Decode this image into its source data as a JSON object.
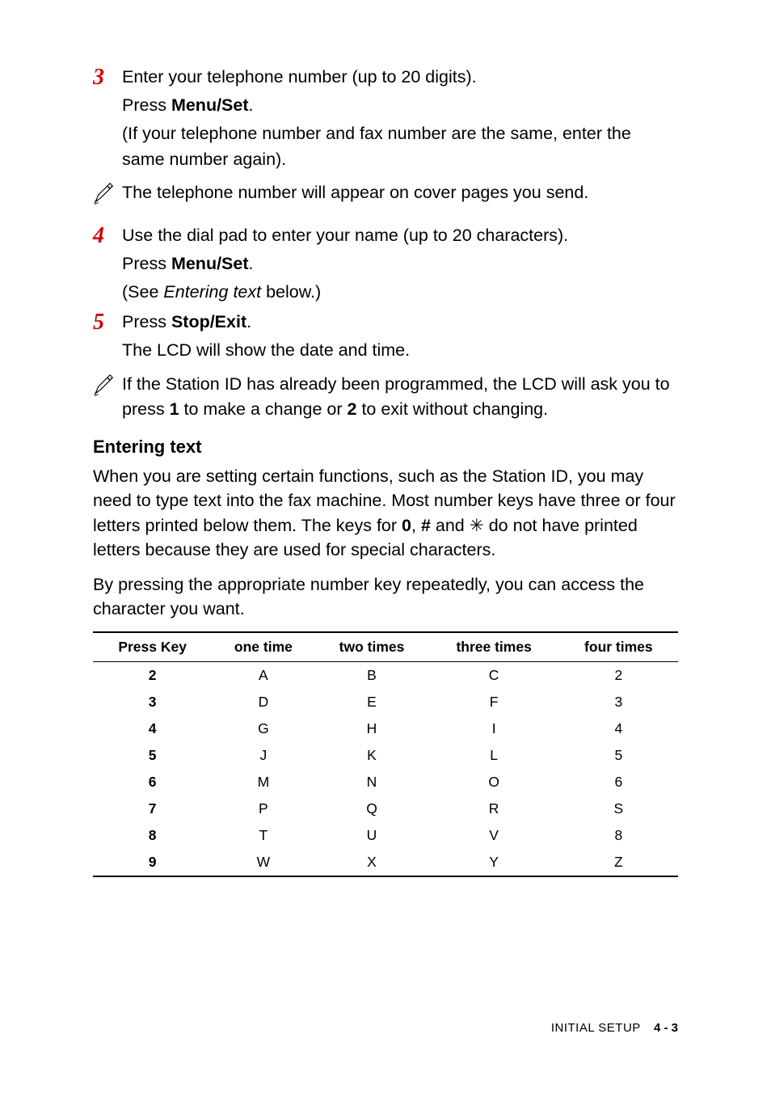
{
  "steps": {
    "s3": {
      "num": "3",
      "line1a": "Enter your telephone number (up to 20 digits).",
      "line2a": "Press ",
      "line2b": "Menu/Set",
      "line2c": ".",
      "line3": "(If your telephone number and fax number are the same, enter the same number again)."
    },
    "s4": {
      "num": "4",
      "line1": "Use the dial pad to enter your name (up to 20 characters).",
      "line2a": "Press ",
      "line2b": "Menu/Set",
      "line2c": ".",
      "line3a": "(See ",
      "line3b": "Entering text",
      "line3c": " below.)"
    },
    "s5": {
      "num": "5",
      "line1a": "Press ",
      "line1b": "Stop/Exit",
      "line1c": ".",
      "line2": "The LCD will show the date and time."
    }
  },
  "notes": {
    "n1": "The telephone number will appear on cover pages you send.",
    "n2a": "If the Station ID has already been programmed, the LCD will ask you to press ",
    "n2b": "1",
    "n2c": " to make a change or ",
    "n2d": "2",
    "n2e": " to exit without changing."
  },
  "section_heading": "Entering text",
  "paras": {
    "p1a": "When you are setting certain functions, such as the Station ID, you may need to type text into the fax machine. Most number keys have three or four letters printed below them. The keys for ",
    "p1b": "0",
    "p1c": ", ",
    "p1d": "#",
    "p1e": " and ",
    "p1star": "✳",
    "p1f": " do not have printed letters because they are used for special characters.",
    "p2": "By pressing the appropriate number key repeatedly, you can access the character you want."
  },
  "table": {
    "headers": [
      "Press Key",
      "one time",
      "two times",
      "three times",
      "four times"
    ],
    "rows": [
      [
        "2",
        "A",
        "B",
        "C",
        "2"
      ],
      [
        "3",
        "D",
        "E",
        "F",
        "3"
      ],
      [
        "4",
        "G",
        "H",
        "I",
        "4"
      ],
      [
        "5",
        "J",
        "K",
        "L",
        "5"
      ],
      [
        "6",
        "M",
        "N",
        "O",
        "6"
      ],
      [
        "7",
        "P",
        "Q",
        "R",
        "S"
      ],
      [
        "8",
        "T",
        "U",
        "V",
        "8"
      ],
      [
        "9",
        "W",
        "X",
        "Y",
        "Z"
      ]
    ]
  },
  "footer": {
    "section": "INITIAL SETUP",
    "page": "4 - 3"
  }
}
